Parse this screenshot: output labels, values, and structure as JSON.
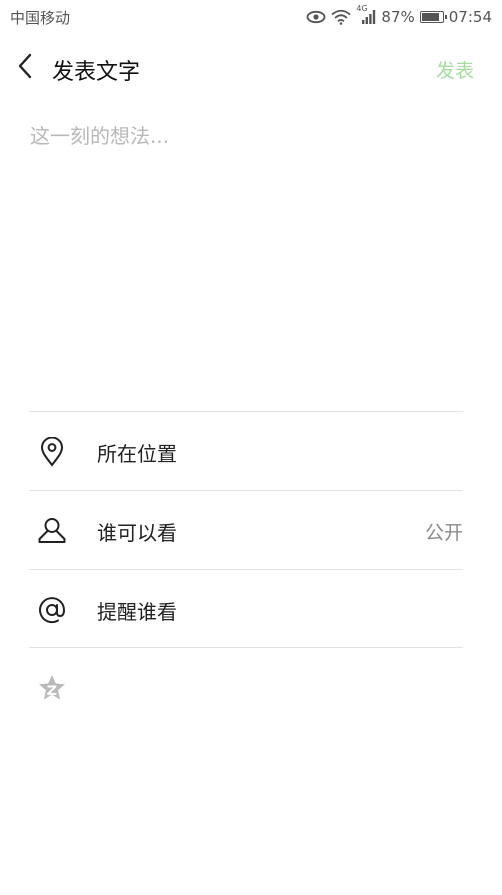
{
  "status_bar": {
    "carrier": "中国移动",
    "network": "4G",
    "battery": "87%",
    "battery_level": 0.87,
    "time": "07:54"
  },
  "navbar": {
    "title": "发表文字",
    "publish_label": "发表"
  },
  "compose": {
    "placeholder": "这一刻的想法..."
  },
  "options": [
    {
      "label": "所在位置",
      "icon": "location-pin-icon"
    },
    {
      "label": "谁可以看",
      "value": "公开",
      "icon": "person-icon"
    },
    {
      "label": "提醒谁看",
      "icon": "at-icon"
    }
  ],
  "extra_icon": "sync-star-icon",
  "colors": {
    "publish_disabled": "#a6dba2",
    "placeholder": "#b8b8b8",
    "divider": "#e3e3e3"
  }
}
